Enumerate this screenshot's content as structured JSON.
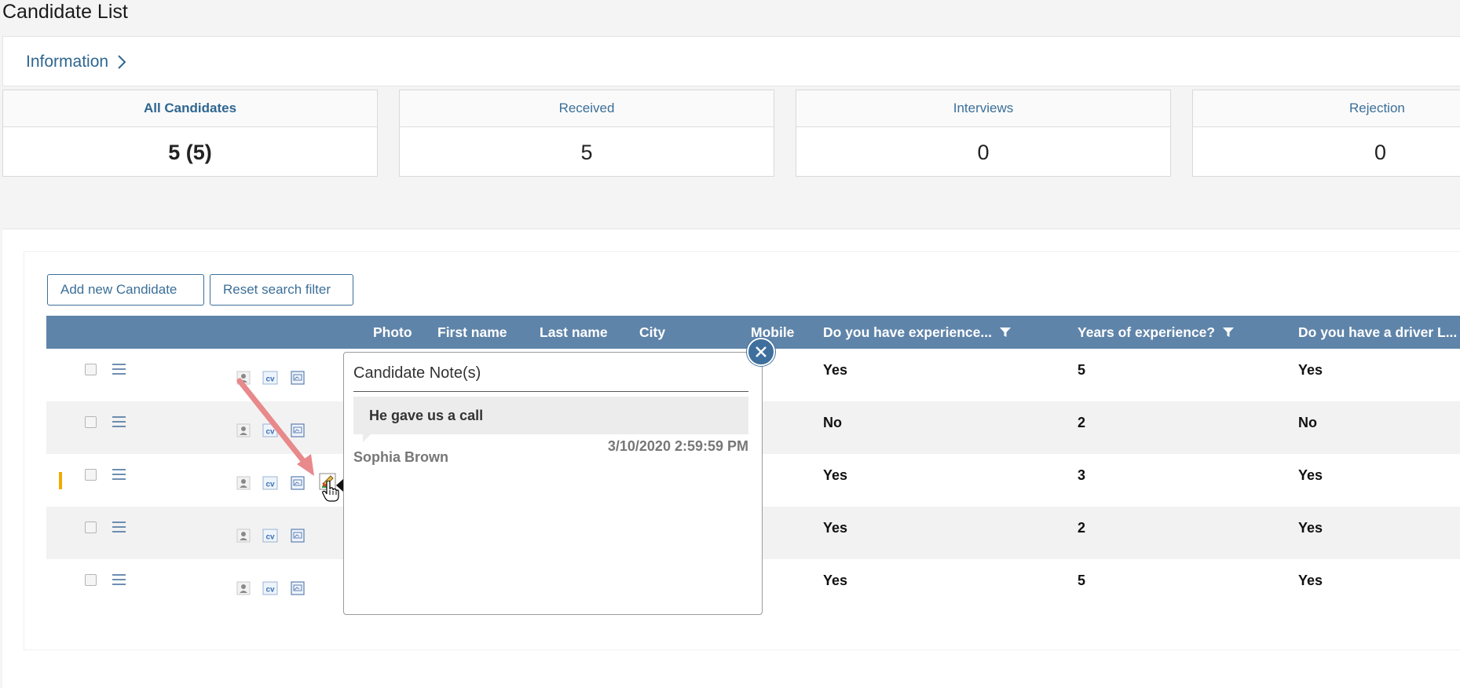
{
  "page": {
    "title": "Candidate List"
  },
  "info": {
    "label": "Information"
  },
  "stats": [
    {
      "label": "All Candidates",
      "value": "5 (5)"
    },
    {
      "label": "Received",
      "value": "5"
    },
    {
      "label": "Interviews",
      "value": "0"
    },
    {
      "label": "Rejection",
      "value": "0"
    }
  ],
  "toolbar": {
    "add_label": "Add new Candidate",
    "reset_label": "Reset search filter"
  },
  "grid": {
    "columns": {
      "photo": "Photo",
      "first_name": "First name",
      "last_name": "Last name",
      "city": "City",
      "mobile": "Mobile",
      "experience": "Do you have experience...",
      "years": "Years of experience?",
      "license": "Do you have a driver L..."
    },
    "icons": {
      "cv": "cv"
    },
    "rows": [
      {
        "experience": "Yes",
        "years": "5",
        "license": "Yes"
      },
      {
        "experience": "No",
        "years": "2",
        "license": "No"
      },
      {
        "experience": "Yes",
        "years": "3",
        "license": "Yes"
      },
      {
        "experience": "Yes",
        "years": "2",
        "license": "Yes"
      },
      {
        "experience": "Yes",
        "years": "5",
        "license": "Yes"
      }
    ]
  },
  "notes_popup": {
    "title": "Candidate Note(s)",
    "note_text": "He gave us a call",
    "author": "Sophia Brown",
    "date": "3/10/2020 2:59:59 PM"
  },
  "colors": {
    "accent": "#3b6f99",
    "grid_header": "#5f84a9",
    "selected_marker": "#f4a800",
    "annotation_arrow": "#e8898b"
  }
}
